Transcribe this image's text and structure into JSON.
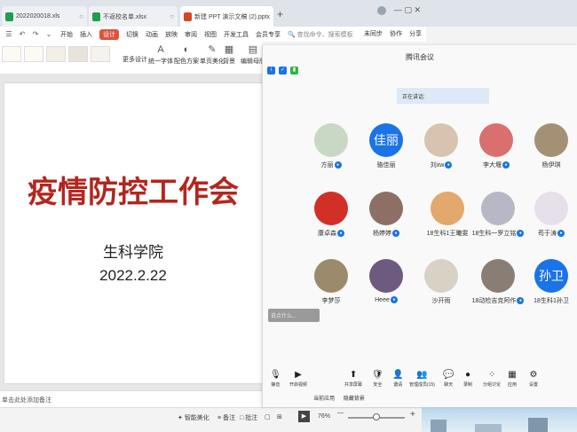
{
  "tabs": [
    {
      "label": "2022020018.xls",
      "color": "#1f9e4b"
    },
    {
      "label": "不返校名单.xlsx",
      "color": "#1f9e4b"
    },
    {
      "label": "新建 PPT 演示文稿 (2).pptx",
      "color": "#d24726"
    }
  ],
  "new_tab": "+",
  "menu": {
    "quick_icons": [
      "☰",
      "↶",
      "↷",
      "⌄"
    ],
    "items": [
      "开始",
      "插入",
      "设计",
      "切换",
      "动画",
      "放映",
      "审阅",
      "视图",
      "开发工具",
      "会员专享"
    ],
    "active": "设计",
    "search": "查找命令、搜索模板",
    "right": [
      "未同步",
      "协作",
      "分享"
    ]
  },
  "ribbon": {
    "buttons": [
      {
        "label": "更多设计",
        "icon": "⊞"
      },
      {
        "label": "统一字体",
        "icon": "A"
      },
      {
        "label": "配色方案",
        "icon": "◐"
      },
      {
        "label": "单页美化",
        "icon": "✎"
      },
      {
        "label": "背景",
        "icon": "▦"
      },
      {
        "label": "编辑母版",
        "icon": "▤"
      }
    ]
  },
  "slide": {
    "title": "疫情防控工作会",
    "subtitle": "生科学院",
    "date": "2022.2.22"
  },
  "notes_placeholder": "单击此处添加备注",
  "statusbar": {
    "beautify": "智能美化",
    "notes": "备注",
    "annotate": "批注",
    "zoom": "76%",
    "zoom_minus": "—",
    "zoom_plus": "+",
    "open_app": "当前应用",
    "open_bar": "隐藏背景"
  },
  "meeting": {
    "title": "腾讯会议",
    "speaking": "正在讲话:",
    "participants": [
      {
        "name": "方丽",
        "avatar_color": "#c9d8c5",
        "initial": ""
      },
      {
        "name": "骆佳丽",
        "avatar_color": "#1a73e8",
        "initial": "佳丽"
      },
      {
        "name": "刘xw",
        "avatar_color": "#d7c3b0",
        "initial": ""
      },
      {
        "name": "李大堰",
        "avatar_color": "#d96f6f",
        "initial": ""
      },
      {
        "name": "杨伊琪",
        "avatar_color": "#a39075",
        "initial": ""
      },
      {
        "name": "康卓森",
        "avatar_color": "#d22f27",
        "initial": ""
      },
      {
        "name": "杨婷婷",
        "avatar_color": "#8d6f66",
        "initial": ""
      },
      {
        "name": "18生科1王曦雯",
        "avatar_color": "#e3a86b",
        "initial": ""
      },
      {
        "name": "18生科一罗立铭",
        "avatar_color": "#b8b7c6",
        "initial": ""
      },
      {
        "name": "苟于涛",
        "avatar_color": "#e6e0ea",
        "initial": ""
      },
      {
        "name": "李梦莎",
        "avatar_color": "#9c8a6c",
        "initial": ""
      },
      {
        "name": "Heee",
        "avatar_color": "#6e5a7e",
        "initial": ""
      },
      {
        "name": "沙开雨",
        "avatar_color": "#d8d2c4",
        "initial": ""
      },
      {
        "name": "18动检吉克阿作",
        "avatar_color": "#8a7e74",
        "initial": ""
      },
      {
        "name": "18生科1孙卫",
        "avatar_color": "#1a73e8",
        "initial": "孙卫"
      }
    ],
    "chat_bubble": "说点什么...",
    "toolbar": [
      {
        "label": "静音",
        "icon": "🎙"
      },
      {
        "label": "开启视频",
        "icon": "▶"
      },
      {
        "label": "共享屏幕",
        "icon": "⬆"
      },
      {
        "label": "安全",
        "icon": "🛡"
      },
      {
        "label": "邀请",
        "icon": "👤"
      },
      {
        "label": "管理成员(15)",
        "icon": "👥"
      },
      {
        "label": "聊天",
        "icon": "💬"
      },
      {
        "label": "录制",
        "icon": "●"
      },
      {
        "label": "分组讨论",
        "icon": "⁘"
      },
      {
        "label": "应用",
        "icon": "▦"
      },
      {
        "label": "设置",
        "icon": "⚙"
      }
    ]
  },
  "colors": {
    "accent": "#e0523b",
    "tencent_blue": "#1a73e8",
    "slide_title": "#b3261e"
  }
}
